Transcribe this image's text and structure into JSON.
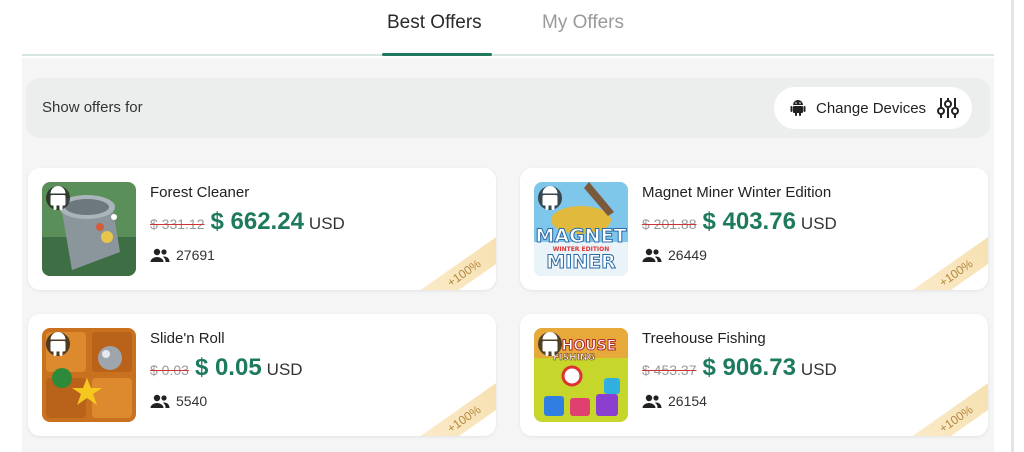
{
  "tabs": [
    {
      "label": "Best Offers",
      "active": true
    },
    {
      "label": "My Offers",
      "active": false
    }
  ],
  "filter": {
    "label": "Show offers for",
    "button_label": "Change Devices"
  },
  "colors": {
    "accent": "#1d7a5e",
    "ribbon": "#f6dfae",
    "strike": "#cc3333"
  },
  "offers": [
    {
      "title": "Forest Cleaner",
      "old_price": "$ 331.12",
      "new_price": "$ 662.24",
      "currency": "USD",
      "users": "27691",
      "bonus": "+100%",
      "icon": "forest-cleaner-thumbnail"
    },
    {
      "title": "Magnet Miner Winter Edition",
      "old_price": "$ 201.88",
      "new_price": "$ 403.76",
      "currency": "USD",
      "users": "26449",
      "bonus": "+100%",
      "icon": "magnet-miner-thumbnail",
      "thumb_text": [
        "MAGNET",
        "WINTER EDITION",
        "MINER"
      ]
    },
    {
      "title": "Slide'n Roll",
      "old_price": "$ 0.03",
      "new_price": "$ 0.05",
      "currency": "USD",
      "users": "5540",
      "bonus": "+100%",
      "icon": "slide-n-roll-thumbnail"
    },
    {
      "title": "Treehouse Fishing",
      "old_price": "$ 453.37",
      "new_price": "$ 906.73",
      "currency": "USD",
      "users": "26154",
      "bonus": "+100%",
      "icon": "treehouse-fishing-thumbnail",
      "thumb_text": [
        "HOUSE",
        "FISHING"
      ]
    }
  ]
}
